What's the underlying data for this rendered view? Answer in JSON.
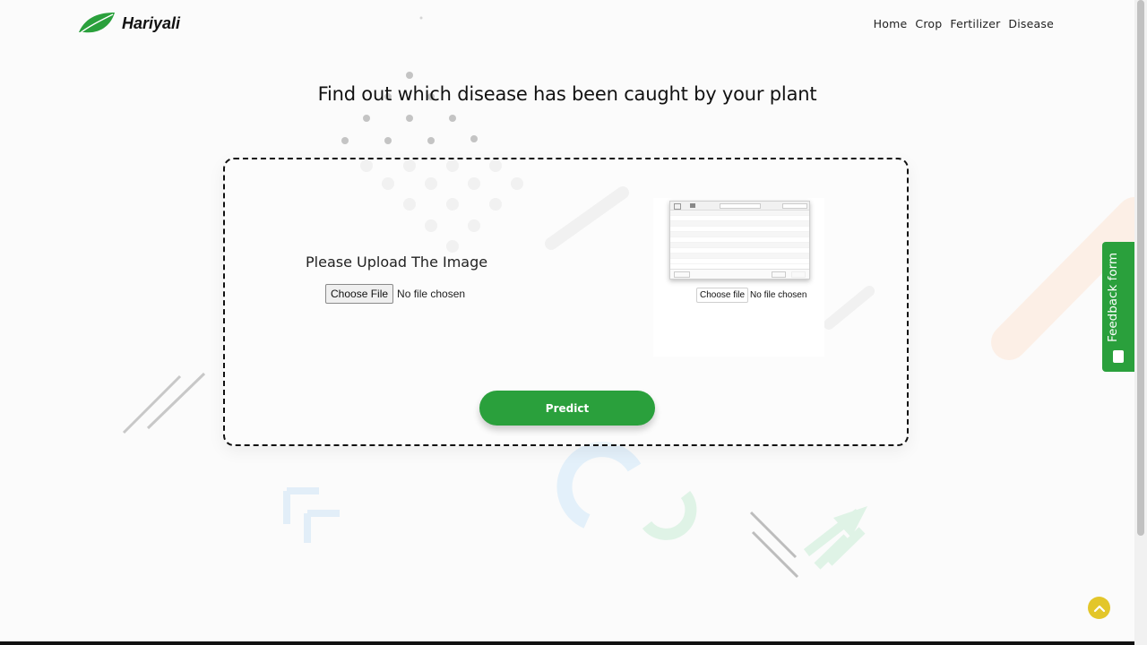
{
  "brand": {
    "name": "Hariyali",
    "icon": "leaf-icon",
    "color": "#2aa03c"
  },
  "nav": {
    "items": [
      {
        "label": "Home"
      },
      {
        "label": "Crop"
      },
      {
        "label": "Fertilizer"
      },
      {
        "label": "Disease"
      }
    ]
  },
  "headline": "Find out which disease has been caught by your plant",
  "upload": {
    "title": "Please Upload The Image",
    "button_label": "Choose File",
    "status": "No file chosen"
  },
  "preview": {
    "button_label": "Choose file",
    "status": "No file chosen"
  },
  "predict_label": "Predict",
  "feedback_label": "Feedback form",
  "scroll_top_icon": "chevron-up-icon",
  "colors": {
    "accent": "#2aa03c",
    "scroll_top": "#e3c62a"
  }
}
